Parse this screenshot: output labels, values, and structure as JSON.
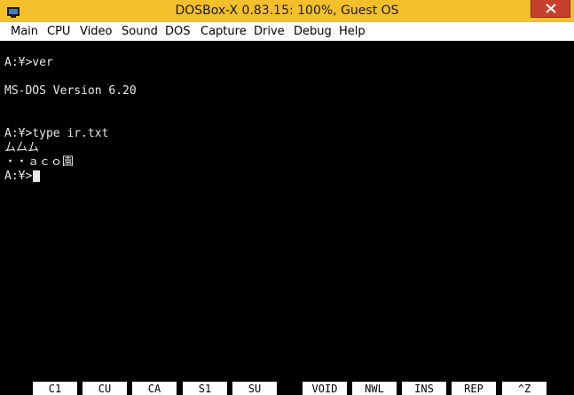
{
  "window": {
    "title": "DOSBox-X 0.83.15: 100%, Guest OS"
  },
  "menu": [
    "Main",
    "CPU",
    "Video",
    "Sound",
    "DOS",
    "Capture",
    "Drive",
    "Debug",
    "Help"
  ],
  "console": {
    "lines": [
      "A:¥>ver",
      "",
      "MS-DOS Version 6.20",
      "",
      "",
      "A:¥>type ir.txt",
      "ム厶ム",
      "・・ａｃｏ園",
      "A:¥>"
    ]
  },
  "function_keys": [
    "C1",
    "CU",
    "CA",
    "S1",
    "SU",
    "VOID",
    "NWL",
    "INS",
    "REP",
    "^Z"
  ],
  "colors": {
    "titlebar": "#f3c02b",
    "close_button": "#c7402e",
    "console_background": "#000000",
    "console_text": "#e8e8e8"
  }
}
